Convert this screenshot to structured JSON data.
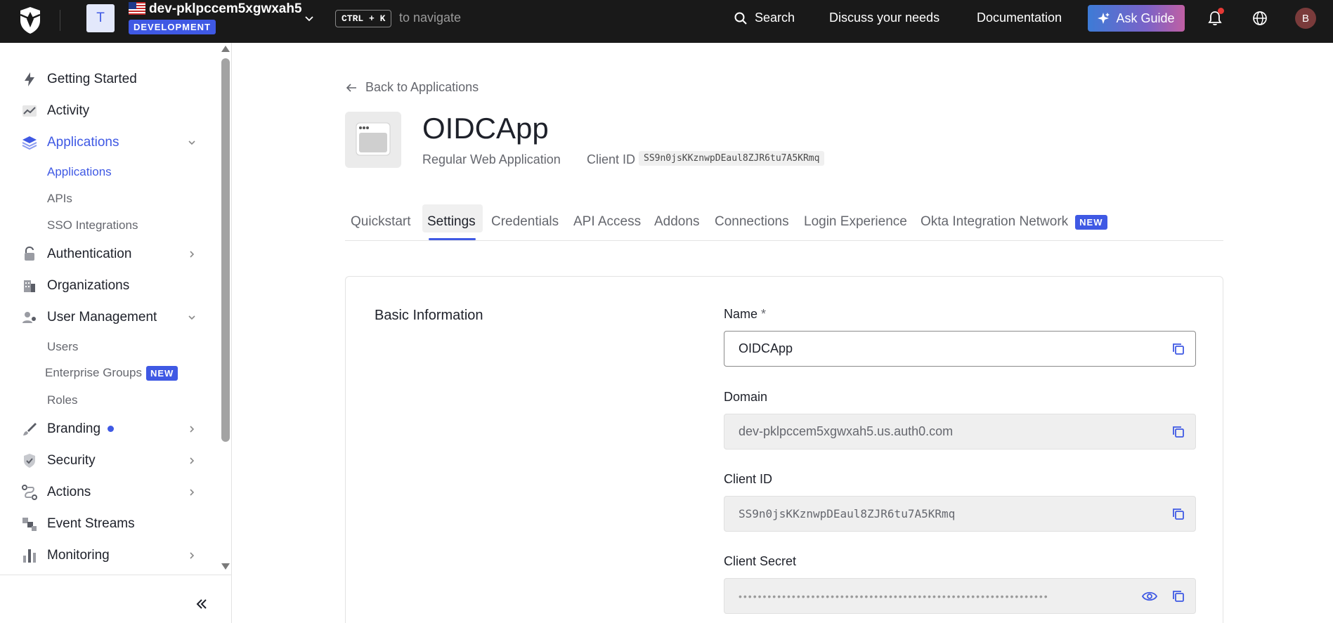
{
  "topbar": {
    "tenant_initial": "T",
    "tenant_name": "dev-pklpccem5xgwxah5",
    "environment": "DEVELOPMENT",
    "shortcut_key": "CTRL + K",
    "shortcut_hint": "to navigate",
    "search_label": "Search",
    "discuss_label": "Discuss your needs",
    "docs_label": "Documentation",
    "ask_guide_label": "Ask Guide",
    "user_initial": "B"
  },
  "sidebar": {
    "items": [
      {
        "label": "Getting Started"
      },
      {
        "label": "Activity"
      },
      {
        "label": "Applications"
      },
      {
        "label": "Authentication"
      },
      {
        "label": "Organizations"
      },
      {
        "label": "User Management"
      },
      {
        "label": "Branding"
      },
      {
        "label": "Security"
      },
      {
        "label": "Actions"
      },
      {
        "label": "Event Streams"
      },
      {
        "label": "Monitoring"
      }
    ],
    "applications_sub": [
      "Applications",
      "APIs",
      "SSO Integrations"
    ],
    "user_management_sub": [
      "Users",
      "Enterprise Groups",
      "Roles"
    ],
    "new_badge": "NEW"
  },
  "main": {
    "back_label": "Back to Applications",
    "app_name": "OIDCApp",
    "app_type": "Regular Web Application",
    "client_id_label": "Client ID",
    "client_id": "SS9n0jsKKznwpDEaul8ZJR6tu7A5KRmq",
    "tabs": [
      "Quickstart",
      "Settings",
      "Credentials",
      "API Access",
      "Addons",
      "Connections",
      "Login Experience",
      "Okta Integration Network"
    ],
    "tab_new_badge": "NEW",
    "section_title": "Basic Information",
    "fields": {
      "name_label": "Name",
      "name_required": "*",
      "name_value": "OIDCApp",
      "domain_label": "Domain",
      "domain_value": "dev-pklpccem5xgwxah5.us.auth0.com",
      "client_id_label": "Client ID",
      "client_id_value": "SS9n0jsKKznwpDEaul8ZJR6tu7A5KRmq",
      "client_secret_label": "Client Secret",
      "client_secret_mask": "••••••••••••••••••••••••••••••••••••••••••••••••••••••••••••••••"
    }
  },
  "colors": {
    "accent": "#3f59e4",
    "topbar_bg": "#191919",
    "notification_dot": "#e53935"
  }
}
